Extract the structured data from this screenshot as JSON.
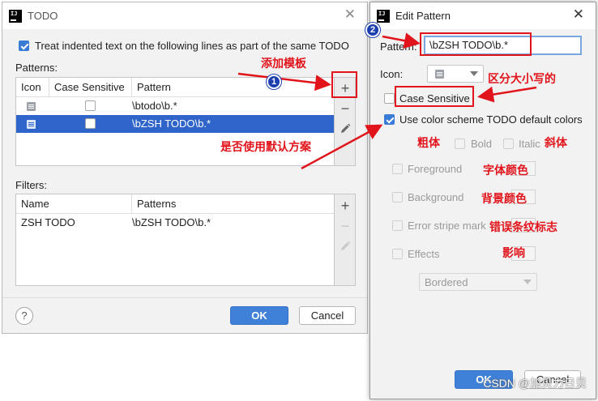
{
  "todo_dialog": {
    "title": "TODO",
    "treat_indented_label": "Treat indented text on the following lines as part of the same TODO",
    "treat_indented_checked": true,
    "patterns_label": "Patterns:",
    "patterns_columns": [
      "Icon",
      "Case Sensitive",
      "Pattern"
    ],
    "patterns_rows": [
      {
        "pattern": "\\btodo\\b.*",
        "case_sensitive": false,
        "selected": false
      },
      {
        "pattern": "\\bZSH TODO\\b.*",
        "case_sensitive": false,
        "selected": true
      }
    ],
    "filters_label": "Filters:",
    "filters_columns": [
      "Name",
      "Patterns"
    ],
    "filters_rows": [
      {
        "name": "ZSH TODO",
        "patterns": "\\bZSH TODO\\b.*"
      }
    ],
    "help_label": "?",
    "ok_label": "OK",
    "cancel_label": "Cancel"
  },
  "edit_dialog": {
    "title": "Edit Pattern",
    "pattern_label": "Pattern:",
    "pattern_value": "\\bZSH TODO\\b.*",
    "icon_label": "Icon:",
    "case_sensitive_label": "Case Sensitive",
    "use_color_scheme_label": "Use color scheme TODO default colors",
    "bold_label": "Bold",
    "italic_label": "Italic",
    "foreground_label": "Foreground",
    "background_label": "Background",
    "error_stripe_label": "Error stripe mark",
    "effects_label": "Effects",
    "effects_value": "Bordered",
    "ok_label": "OK",
    "cancel_label": "Cancel"
  },
  "annotations": {
    "add_template": "添加模板",
    "case_sensitive_note": "区分大小写的",
    "use_default_note": "是否使用默认方案",
    "bold_note": "粗体",
    "italic_note": "斜体",
    "font_color_note": "字体颜色",
    "background_color_note": "背景颜色",
    "error_stripe_note": "错误条纹标志",
    "effects_note": "影响",
    "badge_1": "1",
    "badge_2": "2"
  },
  "watermark": "CSDN @加贝力日贝",
  "colors": {
    "accent": "#3f80d8",
    "selection": "#2f65ca",
    "annotation_red": "#e2141b",
    "badge_blue": "#1c3fae"
  }
}
